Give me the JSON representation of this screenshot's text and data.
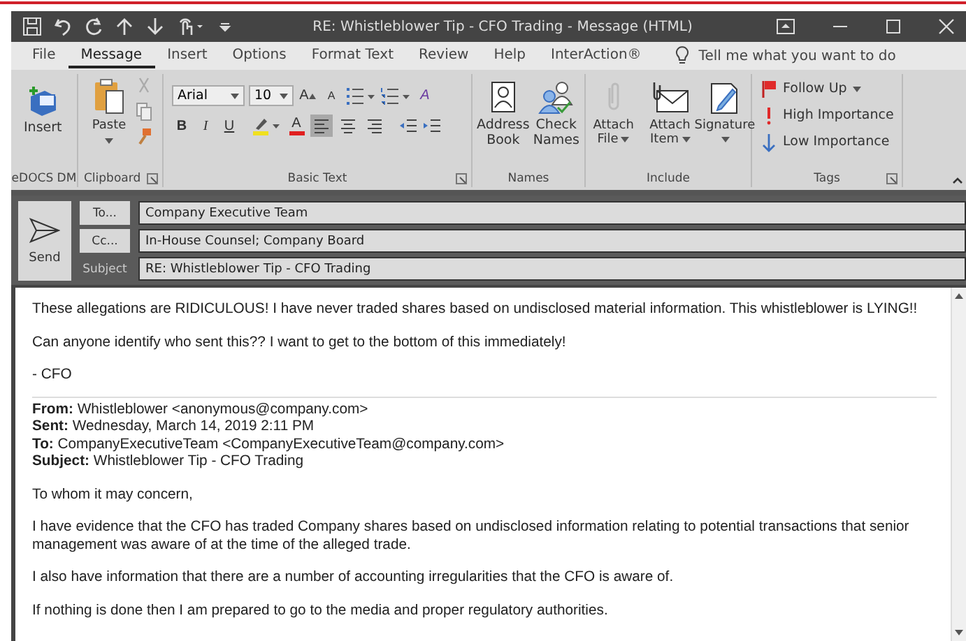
{
  "window": {
    "title": "RE: Whistleblower Tip - CFO Trading  -  Message (HTML)"
  },
  "tabs": [
    {
      "label": "File",
      "selected": false
    },
    {
      "label": "Message",
      "selected": true
    },
    {
      "label": "Insert",
      "selected": false
    },
    {
      "label": "Options",
      "selected": false
    },
    {
      "label": "Format Text",
      "selected": false
    },
    {
      "label": "Review",
      "selected": false
    },
    {
      "label": "Help",
      "selected": false
    },
    {
      "label": "InterAction®",
      "selected": false
    }
  ],
  "tell_me": "Tell me what you want to do",
  "ribbon": {
    "edocs": {
      "label": "eDOCS DM",
      "insert": "Insert"
    },
    "clipboard": {
      "label": "Clipboard",
      "paste": "Paste",
      "launcher": true
    },
    "basic_text": {
      "label": "Basic Text",
      "launcher": true,
      "font": "Arial",
      "size": "10",
      "tools": [
        {
          "kind": "grow",
          "glyph": "A"
        },
        {
          "kind": "shrink",
          "glyph": "A"
        },
        {
          "kind": "bullets"
        },
        {
          "kind": "numbering"
        },
        {
          "kind": "clear",
          "glyph": "A"
        }
      ],
      "format": [
        {
          "kind": "bold",
          "glyph": "B"
        },
        {
          "kind": "italic",
          "glyph": "I"
        },
        {
          "kind": "underline",
          "glyph": "U"
        },
        {
          "kind": "highlight"
        },
        {
          "kind": "font-color",
          "glyph": "A"
        },
        {
          "kind": "align-left",
          "selected": true
        },
        {
          "kind": "align-center",
          "selected": false
        },
        {
          "kind": "align-right",
          "selected": false
        },
        {
          "kind": "outdent"
        },
        {
          "kind": "indent"
        }
      ]
    },
    "names": {
      "label": "Names",
      "buttons": [
        {
          "kind": "address-book",
          "label": "Address Book"
        },
        {
          "kind": "check-names",
          "label": "Check Names"
        }
      ]
    },
    "include": {
      "label": "Include",
      "buttons": [
        {
          "kind": "attach-file",
          "label": "Attach File",
          "dropdown": true
        },
        {
          "kind": "attach-item",
          "label": "Attach Item",
          "dropdown": true
        },
        {
          "kind": "signature",
          "label": "Signature",
          "dropdown": true
        }
      ]
    },
    "tags": {
      "label": "Tags",
      "launcher": true,
      "items": [
        {
          "kind": "follow-up",
          "label": "Follow Up",
          "dropdown": true
        },
        {
          "kind": "high",
          "label": "High Importance",
          "dropdown": false
        },
        {
          "kind": "low",
          "label": "Low Importance",
          "dropdown": false
        }
      ]
    }
  },
  "send": "Send",
  "fields": [
    {
      "kind": "button",
      "label": "To...",
      "value": "Company Executive Team"
    },
    {
      "kind": "button",
      "label": "Cc...",
      "value": "In-House Counsel; Company Board"
    },
    {
      "kind": "label",
      "label": "Subject",
      "value": "RE: Whistleblower Tip - CFO Trading"
    }
  ],
  "body": [
    {
      "kind": "text",
      "text": "These allegations are RIDICULOUS! I have never traded shares based on undisclosed material information. This whistleblower is LYING!!"
    },
    {
      "kind": "text",
      "text": "Can anyone identify who sent this?? I want to get to the bottom of this immediately!"
    },
    {
      "kind": "text",
      "text": "- CFO"
    },
    {
      "kind": "divider"
    },
    {
      "kind": "header",
      "lines": [
        "**From:** Whistleblower <anonymous@company.com>",
        "**Sent:** Wednesday, March 14, 2019 2:11 PM",
        "**To:** CompanyExecutiveTeam <CompanyExecutiveTeam@company.com>",
        "**Subject:** Whistleblower Tip - CFO Trading"
      ]
    },
    {
      "kind": "text",
      "text": "To whom it may concern,"
    },
    {
      "kind": "text",
      "text": "I have evidence that the CFO has traded Company shares based on undisclosed information relating to potential transactions that senior management was aware of at the time of the alleged trade."
    },
    {
      "kind": "text",
      "text": "I also have information that there are a number of accounting irregularities that the CFO is aware of."
    },
    {
      "kind": "text",
      "text": "If nothing is done then I am prepared to go to the media and proper regulatory authorities."
    }
  ]
}
